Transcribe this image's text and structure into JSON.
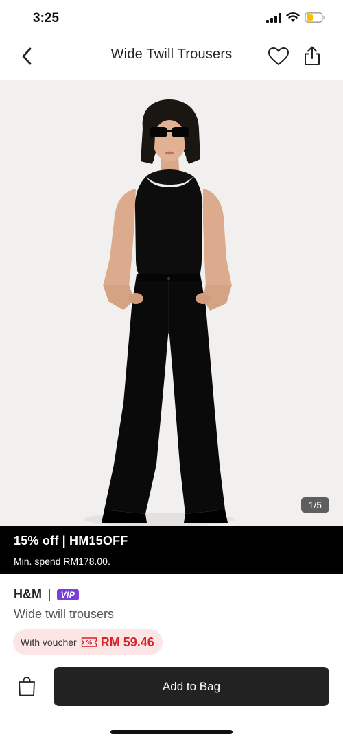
{
  "status_bar": {
    "time": "3:25"
  },
  "nav": {
    "title": "Wide Twill Trousers",
    "icons": [
      "back-icon",
      "heart-icon",
      "share-icon"
    ]
  },
  "hero": {
    "image_counter": "1/5",
    "background_color": "#f1f0ef"
  },
  "promo": {
    "title": "15% off | HM15OFF",
    "subtitle": "Min. spend RM178.00."
  },
  "product": {
    "brand": "H&M",
    "badge": "VIP",
    "name": "Wide twill trousers",
    "price_label": "With voucher",
    "price": "RM 59.46",
    "price_color": "#d8232a"
  },
  "actions": {
    "add_to_bag": "Add to Bag",
    "icons": [
      "bag-icon"
    ]
  },
  "colors": {
    "primary_button": "#222222",
    "vip_badge": "#7a3fd6",
    "battery": "#f5c400"
  }
}
